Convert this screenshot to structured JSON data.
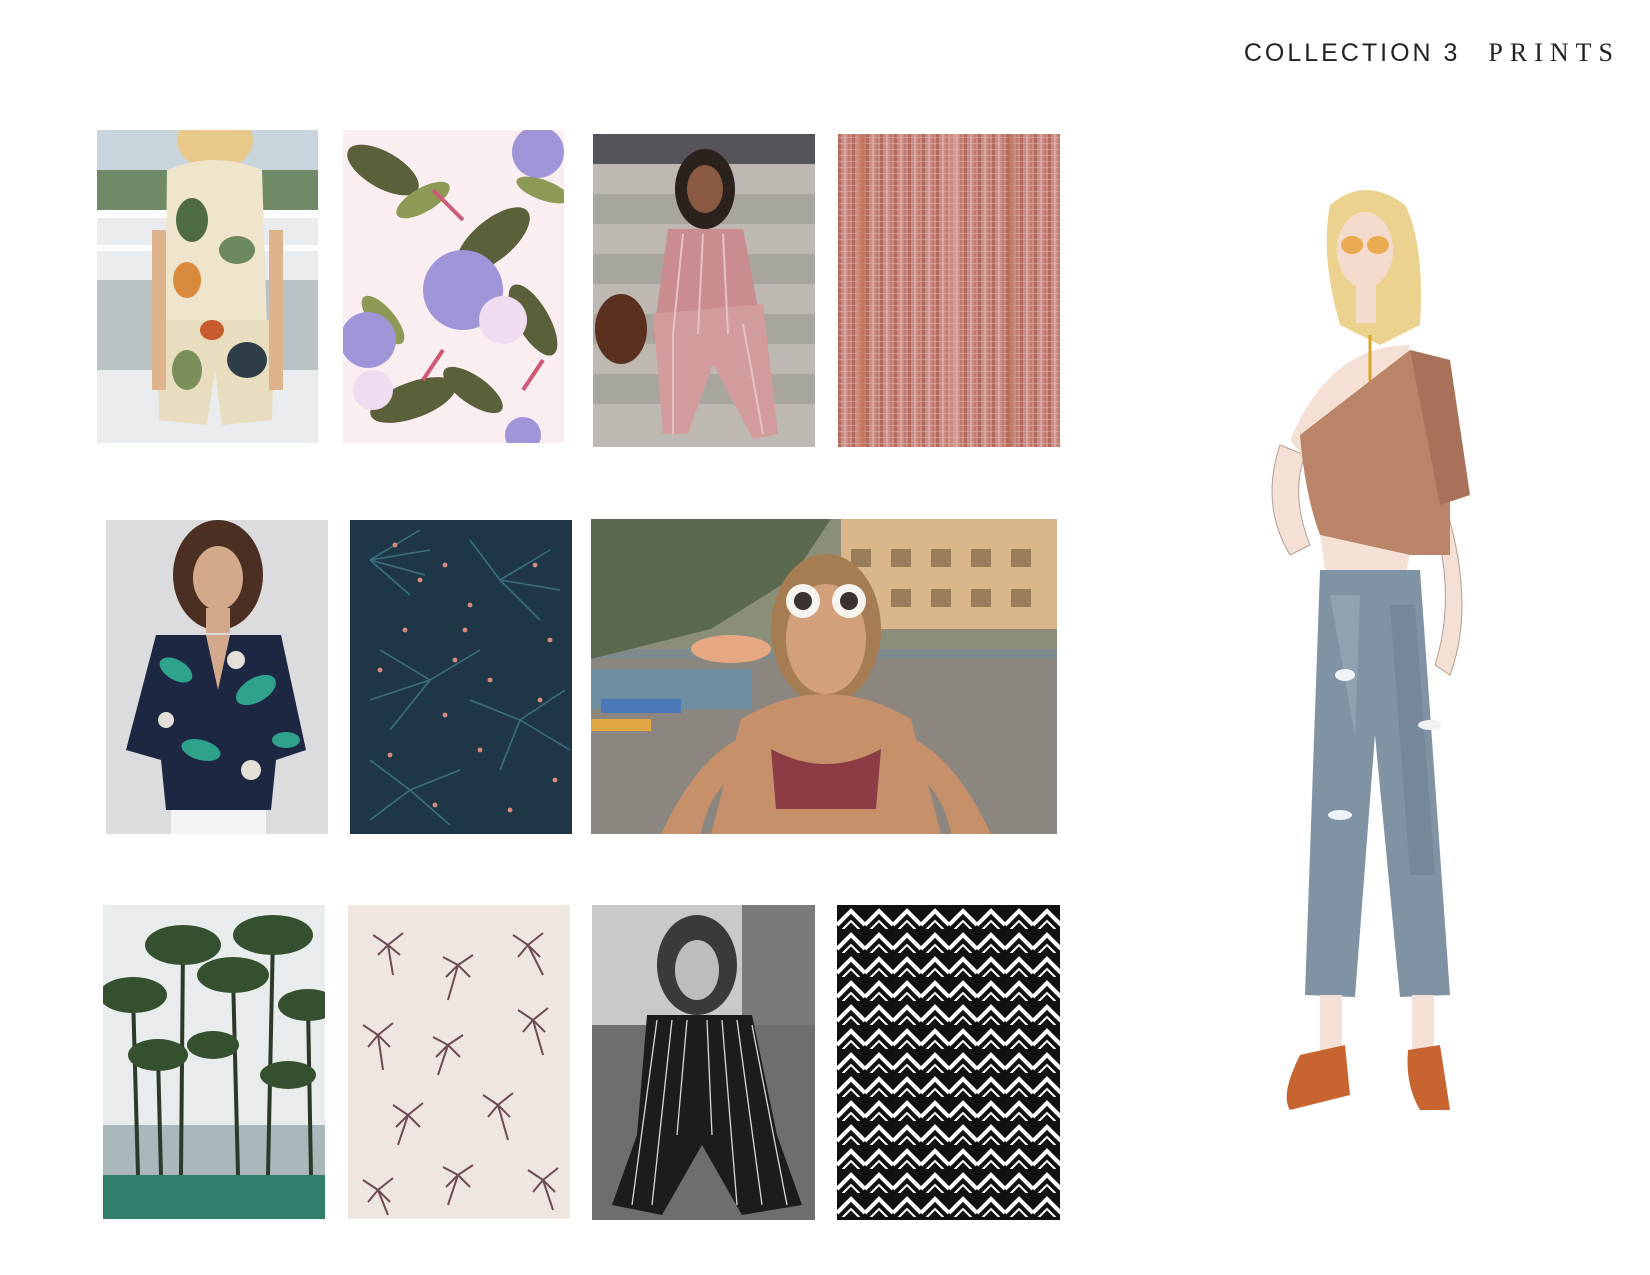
{
  "header": {
    "collection_label": "COLLECTION 3",
    "prints_label": "PRINTS"
  },
  "tiles": [
    {
      "subject": "tropical-print-romper-photo"
    },
    {
      "subject": "hibiscus-floral-print-swatch"
    },
    {
      "subject": "pink-stripe-pajama-set-photo"
    },
    {
      "subject": "rose-woven-stripe-texture"
    },
    {
      "subject": "navy-tropical-shirt-photo"
    },
    {
      "subject": "navy-palm-frond-print-swatch"
    },
    {
      "subject": "beach-sunglasses-photo"
    },
    {
      "subject": "palm-trees-photo"
    },
    {
      "subject": "palm-tree-print-swatch"
    },
    {
      "subject": "pinstripe-suit-bw-photo"
    },
    {
      "subject": "black-white-herringbone-print-swatch"
    }
  ],
  "sketch": {
    "subject": "fashion-illustration-one-shoulder-top-cropped-jeans"
  },
  "colors": {
    "rose": "#c98c86",
    "navy": "#1f3646",
    "terracotta": "#b98467",
    "denim": "#7f93a4",
    "shoe": "#c7642f"
  }
}
